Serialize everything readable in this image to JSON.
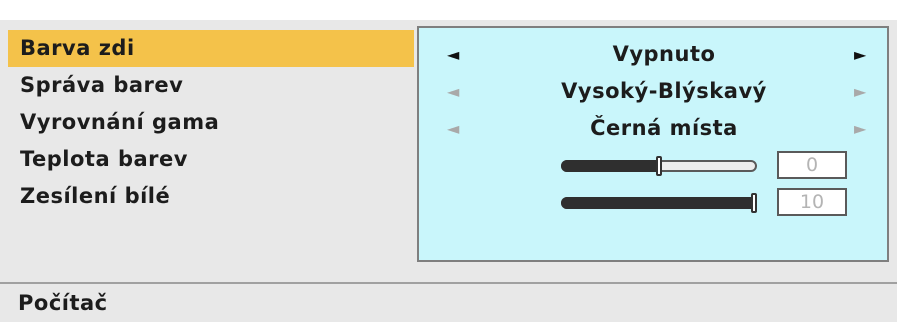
{
  "menu": {
    "items": [
      {
        "label": "Barva zdi",
        "selected": true
      },
      {
        "label": "Správa barev",
        "selected": false
      },
      {
        "label": "Vyrovnání gama",
        "selected": false
      },
      {
        "label": "Teplota barev",
        "selected": false
      },
      {
        "label": "Zesílení bílé",
        "selected": false
      }
    ]
  },
  "values": {
    "wall_color": {
      "text": "Vypnuto",
      "arrows_active": true
    },
    "color_management": {
      "text": "Vysoký-Blýskavý",
      "arrows_active": false
    },
    "gamma_correction": {
      "text": "Černá místa",
      "arrows_active": false
    },
    "color_temperature": {
      "value": "0",
      "level": 0.5
    },
    "white_gain": {
      "value": "10",
      "level": 1.0
    }
  },
  "arrows": {
    "left": "◄",
    "right": "►"
  },
  "footer": {
    "label": "Počítač"
  },
  "colors": {
    "selection_highlight": "#f4c24a",
    "value_panel": "#c9f6fb",
    "menu_background": "#e8e8e8"
  }
}
